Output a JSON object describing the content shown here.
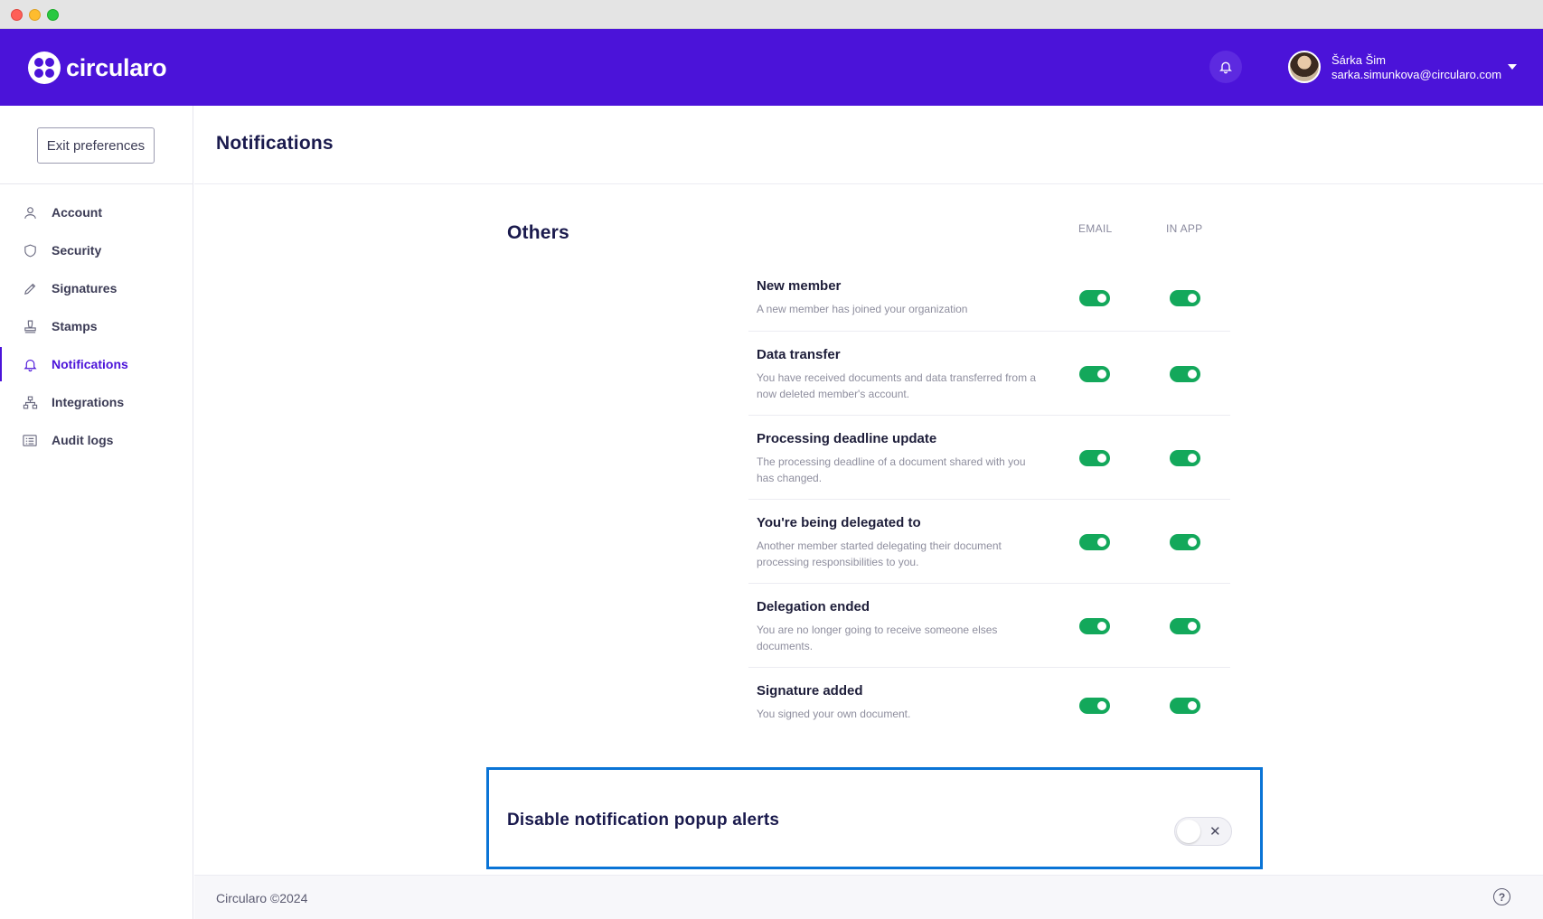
{
  "app": {
    "brand": "circularo",
    "user_name": "Šárka Šim",
    "user_email": "sarka.simunkova@circularo.com",
    "accent_color": "#4b13d9"
  },
  "sidebar": {
    "exit_label": "Exit preferences",
    "items": [
      {
        "label": "Account",
        "icon": "user-icon",
        "active": false
      },
      {
        "label": "Security",
        "icon": "shield-icon",
        "active": false
      },
      {
        "label": "Signatures",
        "icon": "pen-icon",
        "active": false
      },
      {
        "label": "Stamps",
        "icon": "stamp-icon",
        "active": false
      },
      {
        "label": "Notifications",
        "icon": "bell-icon",
        "active": true
      },
      {
        "label": "Integrations",
        "icon": "network-icon",
        "active": false
      },
      {
        "label": "Audit logs",
        "icon": "list-icon",
        "active": false
      }
    ]
  },
  "main": {
    "title": "Notifications",
    "section_title": "Others",
    "col_email": "EMAIL",
    "col_in_app": "IN APP",
    "rows": [
      {
        "title": "New member",
        "desc": "A new member has joined your organization",
        "email": true,
        "in_app": true
      },
      {
        "title": "Data transfer",
        "desc": "You have received documents and data transferred from a now deleted member's account.",
        "email": true,
        "in_app": true
      },
      {
        "title": "Processing deadline update",
        "desc": "The processing deadline of a document shared with you has changed.",
        "email": true,
        "in_app": true
      },
      {
        "title": "You're being delegated to",
        "desc": "Another member started delegating their document processing responsibilities to you.",
        "email": true,
        "in_app": true
      },
      {
        "title": "Delegation ended",
        "desc": "You are no longer going to receive someone elses documents.",
        "email": true,
        "in_app": true
      },
      {
        "title": "Signature added",
        "desc": "You signed your own document.",
        "email": true,
        "in_app": true
      }
    ],
    "disable_popup": {
      "title": "Disable notification popup alerts",
      "enabled": false,
      "toggle_symbol": "✕"
    }
  },
  "footer": {
    "copyright": "Circularo ©2024",
    "help_symbol": "?"
  }
}
